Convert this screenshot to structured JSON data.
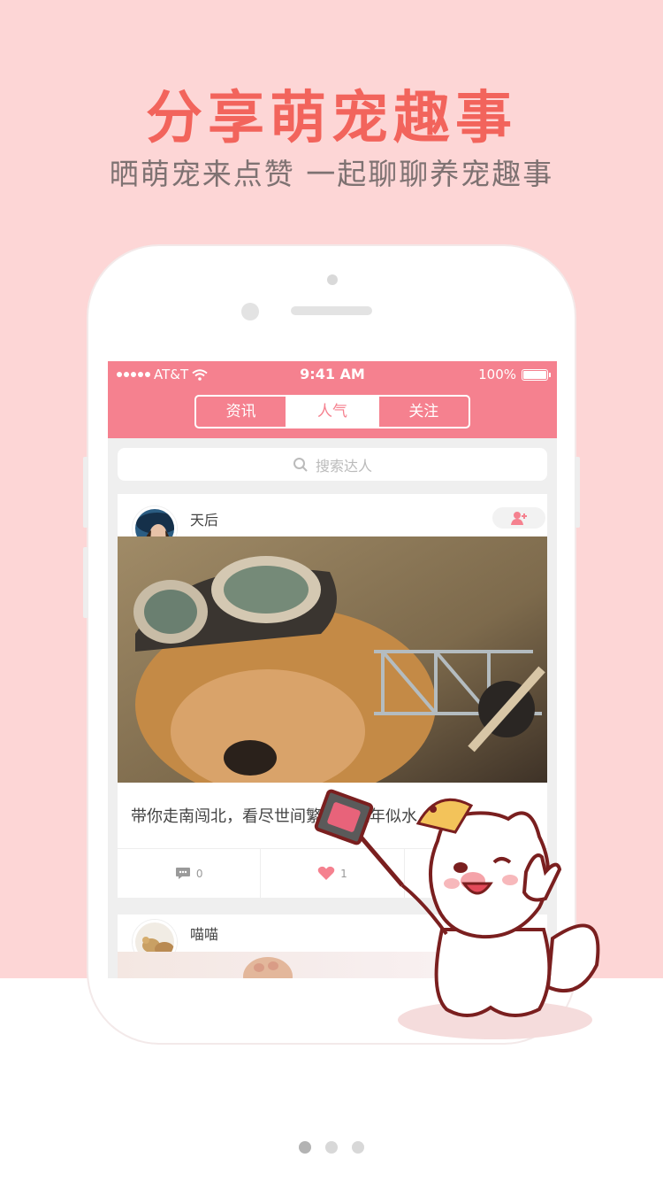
{
  "headline": "分享萌宠趣事",
  "subline": "晒萌宠来点赞  一起聊聊养宠趣事",
  "status_bar": {
    "carrier": "AT&T",
    "time": "9:41 AM",
    "battery": "100%"
  },
  "tabs": [
    {
      "label": "资讯",
      "active": false
    },
    {
      "label": "人气",
      "active": true
    },
    {
      "label": "关注",
      "active": false
    }
  ],
  "search": {
    "placeholder": "搜索达人",
    "icon": "search-icon"
  },
  "posts": [
    {
      "username": "天后",
      "caption": "带你走南闯北，看尽世间繁华，流年似水，列车",
      "comments": "0",
      "likes": "1"
    },
    {
      "username": "喵喵"
    }
  ],
  "pager": {
    "total": 3,
    "current": 1
  },
  "colors": {
    "accent": "#f5818f",
    "headline": "#f2645c",
    "background": "#fdd6d6"
  }
}
